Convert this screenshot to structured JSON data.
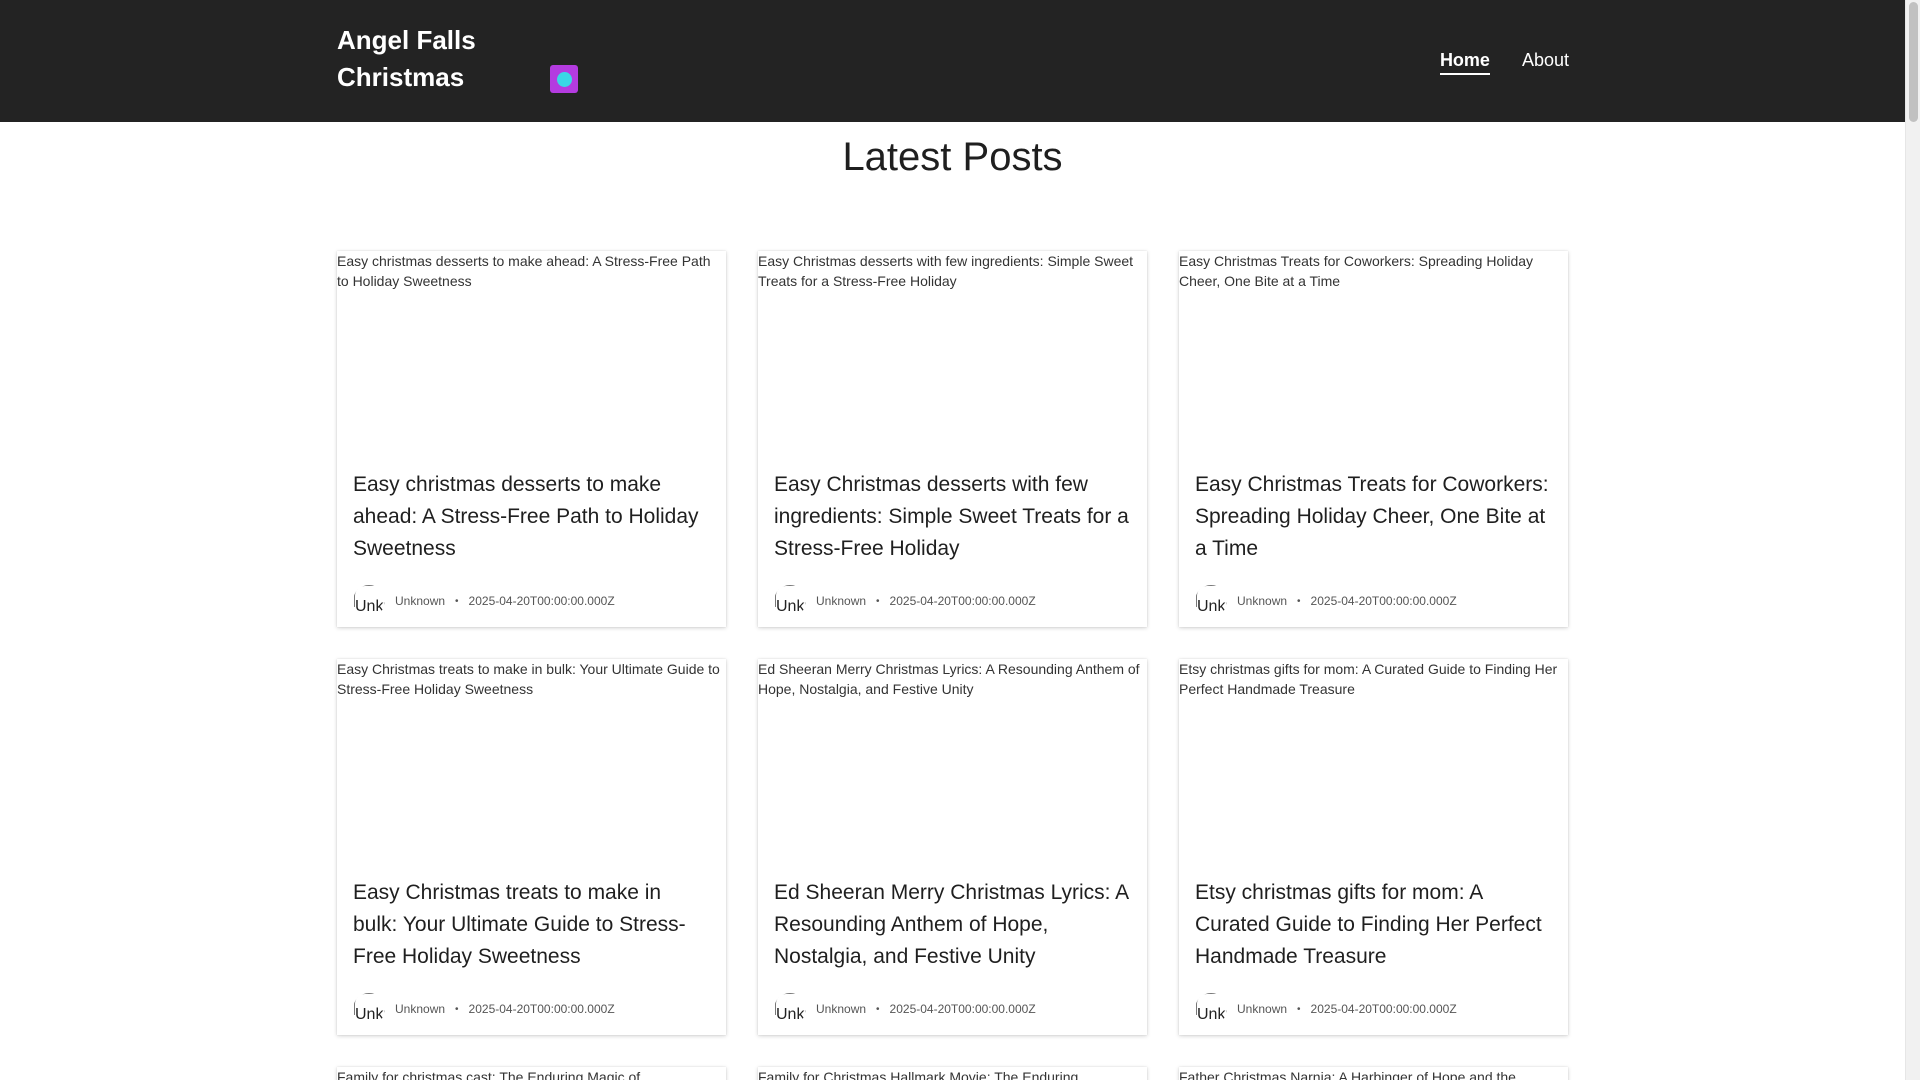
{
  "header": {
    "brand": "Angel Falls Christmas",
    "nav": [
      {
        "label": "Home",
        "active": true
      },
      {
        "label": "About",
        "active": false
      }
    ],
    "toggle_colors": {
      "outer": "#b43be0",
      "inner": "#3ad7e6"
    }
  },
  "main": {
    "title": "Latest Posts",
    "posts": [
      {
        "image_alt": "Easy christmas desserts to make ahead: A Stress-Free Path to Holiday Sweetness",
        "title": "Easy christmas desserts to make ahead: A Stress-Free Path to Holiday Sweetness",
        "author": "Unknown",
        "avatar_alt": "Unknown",
        "date": "2025-04-20T00:00:00.000Z"
      },
      {
        "image_alt": "Easy Christmas desserts with few ingredients: Simple Sweet Treats for a Stress-Free Holiday",
        "title": "Easy Christmas desserts with few ingredients: Simple Sweet Treats for a Stress-Free Holiday",
        "author": "Unknown",
        "avatar_alt": "Unknown",
        "date": "2025-04-20T00:00:00.000Z"
      },
      {
        "image_alt": "Easy Christmas Treats for Coworkers: Spreading Holiday Cheer, One Bite at a Time",
        "title": "Easy Christmas Treats for Coworkers: Spreading Holiday Cheer, One Bite at a Time",
        "author": "Unknown",
        "avatar_alt": "Unknown",
        "date": "2025-04-20T00:00:00.000Z"
      },
      {
        "image_alt": "Easy Christmas treats to make in bulk: Your Ultimate Guide to Stress-Free Holiday Sweetness",
        "title": "Easy Christmas treats to make in bulk: Your Ultimate Guide to Stress-Free Holiday Sweetness",
        "author": "Unknown",
        "avatar_alt": "Unknown",
        "date": "2025-04-20T00:00:00.000Z"
      },
      {
        "image_alt": "Ed Sheeran Merry Christmas Lyrics: A Resounding Anthem of Hope, Nostalgia, and Festive Unity",
        "title": "Ed Sheeran Merry Christmas Lyrics: A Resounding Anthem of Hope, Nostalgia, and Festive Unity",
        "author": "Unknown",
        "avatar_alt": "Unknown",
        "date": "2025-04-20T00:00:00.000Z"
      },
      {
        "image_alt": "Etsy christmas gifts for mom: A Curated Guide to Finding Her Perfect Handmade Treasure",
        "title": "Etsy christmas gifts for mom: A Curated Guide to Finding Her Perfect Handmade Treasure",
        "author": "Unknown",
        "avatar_alt": "Unknown",
        "date": "2025-04-20T00:00:00.000Z"
      }
    ],
    "partial_posts": [
      {
        "image_alt": "Family for christmas cast: The Enduring Magic of"
      },
      {
        "image_alt": "Family for Christmas Hallmark Movie: The Enduring"
      },
      {
        "image_alt": "Father Christmas Narnia: A Harbinger of Hope and the"
      }
    ]
  }
}
